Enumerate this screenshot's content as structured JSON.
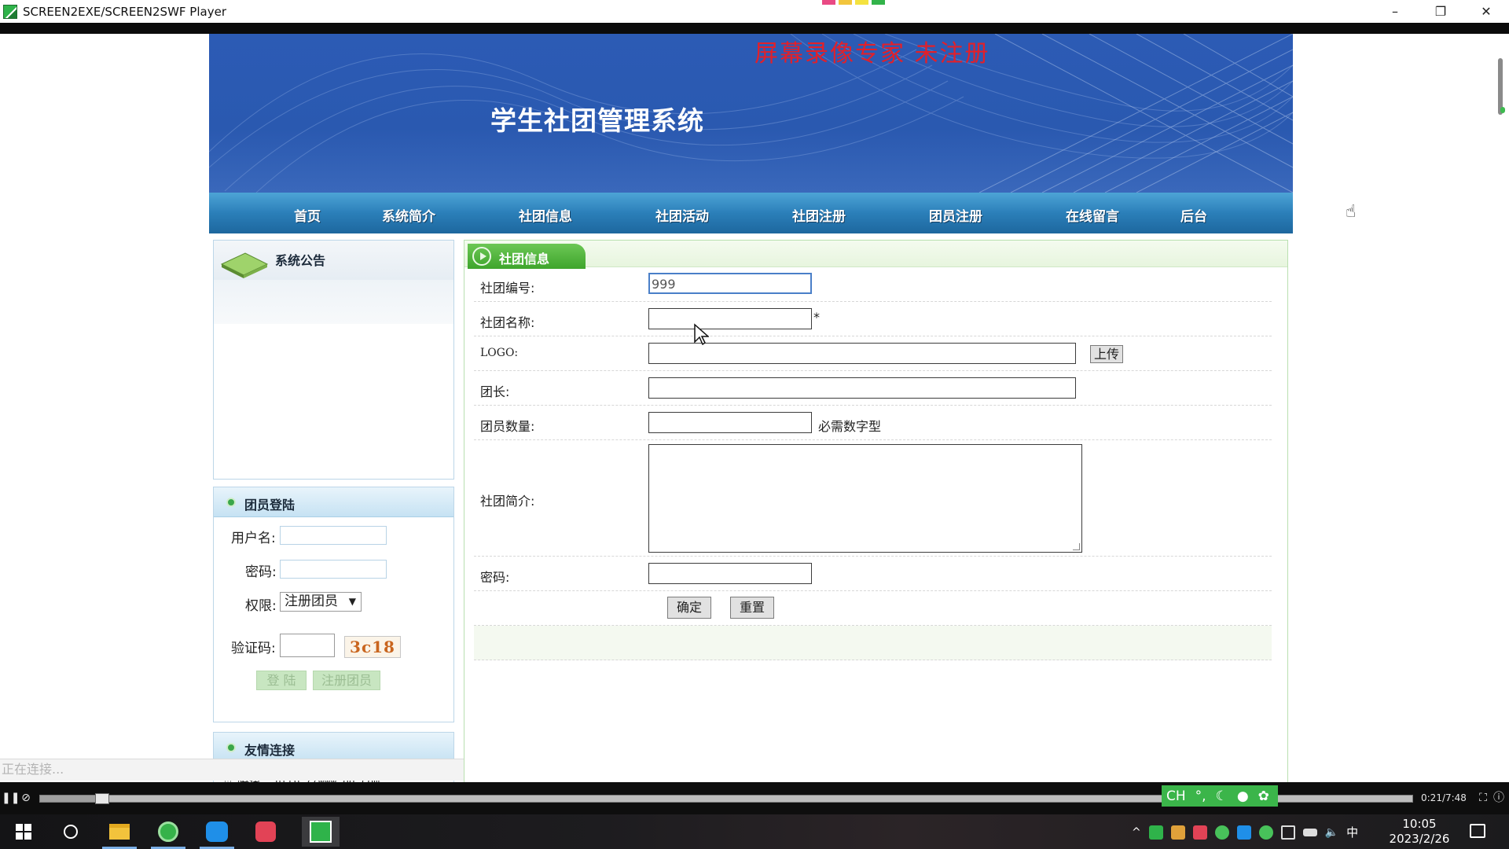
{
  "window": {
    "title": "SCREEN2EXE/SCREEN2SWF Player",
    "minimize": "–",
    "restore": "❐",
    "close": "✕"
  },
  "watermark": "屏幕录像专家  未注册",
  "site": {
    "title": "学生社团管理系统",
    "nav": [
      "首页",
      "系统简介",
      "社团信息",
      "社团活动",
      "社团注册",
      "团员注册",
      "在线留言",
      "后台"
    ]
  },
  "sidebar": {
    "notice_title": "系统公告",
    "login": {
      "title": "团员登陆",
      "username_label": "用户名:",
      "password_label": "密码:",
      "role_label": "权限:",
      "role_value": "注册团员",
      "captcha_label": "验证码:",
      "captcha_code": "3c18",
      "login_button": "登 陆",
      "register_button": "注册团员"
    },
    "links": {
      "title": "友情连接",
      "items": [
        {
          "name": "腾讯",
          "url": "http://www.qq.com"
        }
      ]
    }
  },
  "status_text": "正在连接...",
  "form": {
    "title": "社团信息",
    "fields": {
      "club_id": {
        "label": "社团编号:",
        "value": "999"
      },
      "club_name": {
        "label": "社团名称:",
        "required_mark": "*"
      },
      "logo": {
        "label": "LOGO:",
        "upload_button": "上传"
      },
      "leader": {
        "label": "团长:"
      },
      "member_count": {
        "label": "团员数量:",
        "hint": "必需数字型"
      },
      "intro": {
        "label": "社团简介:"
      },
      "password": {
        "label": "密码:"
      }
    },
    "submit_button": "确定",
    "reset_button": "重置"
  },
  "player": {
    "time": "0:21/7:48",
    "progress": 0.045,
    "ime": "CH"
  },
  "taskbar": {
    "time": "10:05",
    "date": "2023/2/26",
    "ime_indicator": "中"
  }
}
